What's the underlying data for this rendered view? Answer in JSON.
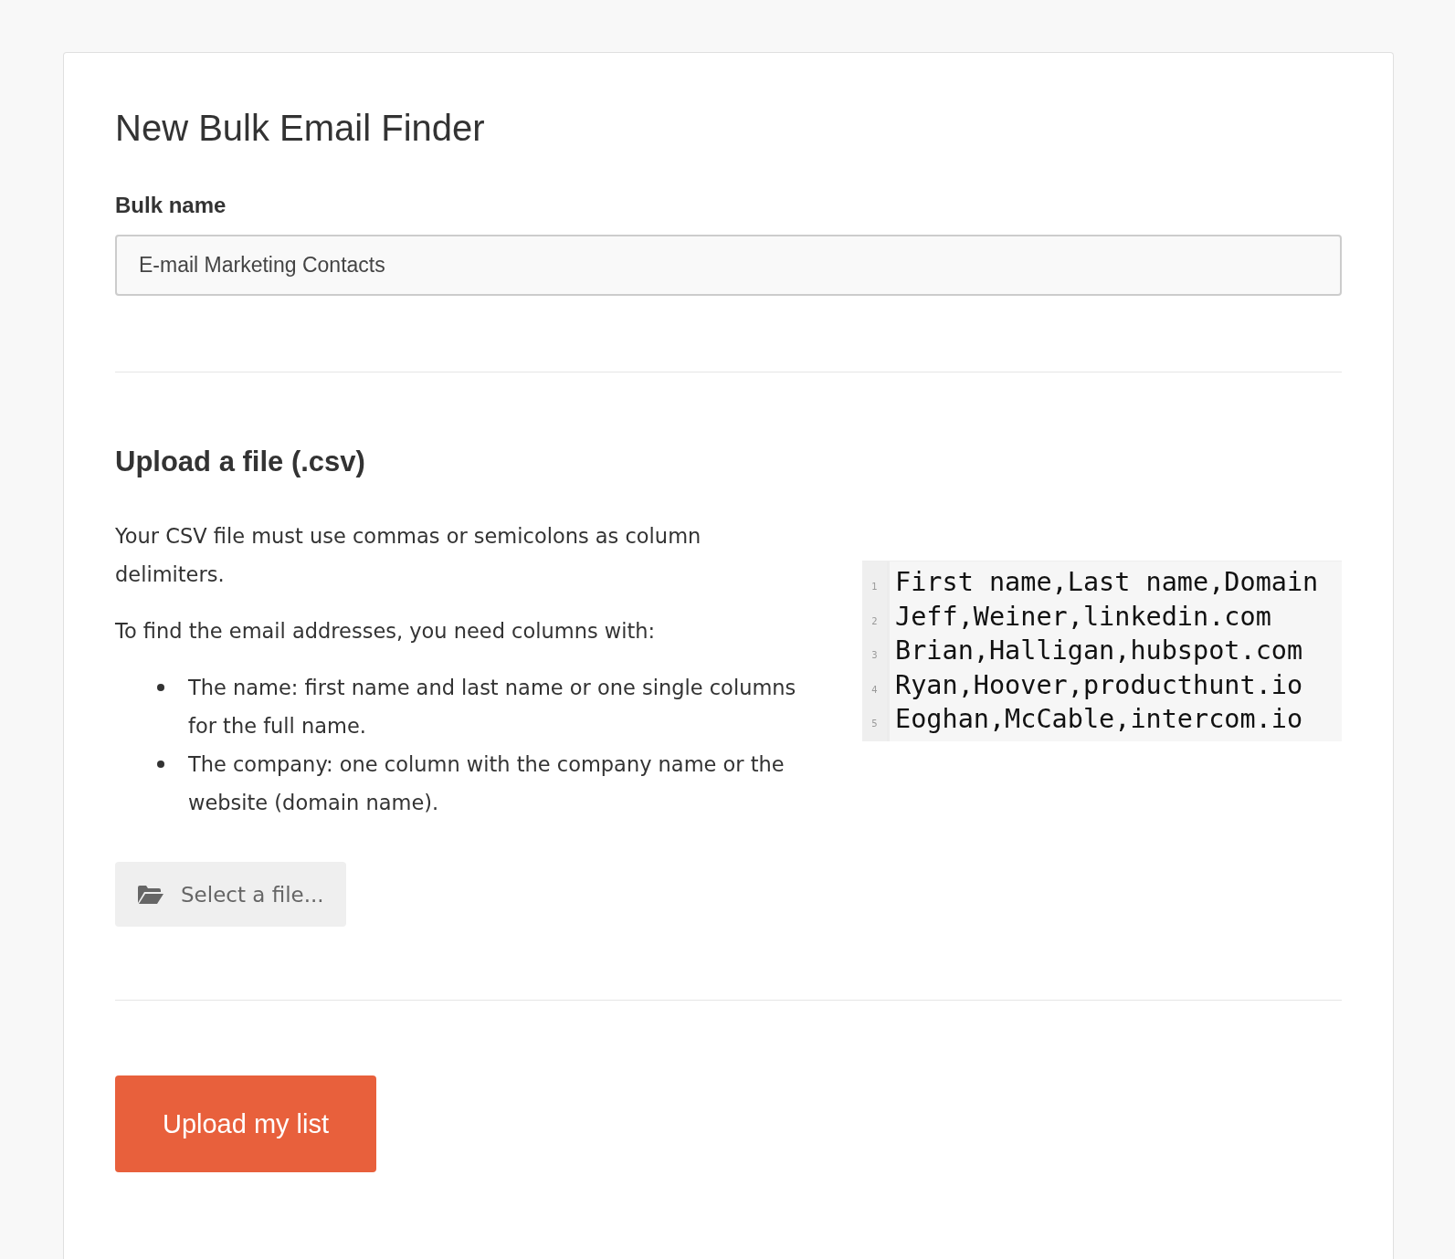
{
  "title": "New Bulk Email Finder",
  "bulk_name": {
    "label": "Bulk name",
    "value": "E-mail Marketing Contacts"
  },
  "upload": {
    "heading": "Upload a file (.csv)",
    "paragraphs": [
      "Your CSV file must use commas or semicolons as column delimiters.",
      "To find the email addresses, you need columns with:"
    ],
    "bullets": [
      "The name: first name and last name or one single columns for the full name.",
      "The company: one column with the company name or the website (domain name)."
    ],
    "sample": [
      {
        "number": "1",
        "text": "First name,Last name,Domain"
      },
      {
        "number": "2",
        "text": "Jeff,Weiner,linkedin.com"
      },
      {
        "number": "3",
        "text": "Brian,Halligan,hubspot.com"
      },
      {
        "number": "4",
        "text": "Ryan,Hoover,producthunt.io"
      },
      {
        "number": "5",
        "text": "Eoghan,McCable,intercom.io"
      }
    ],
    "select_button": "Select a file..."
  },
  "submit_button": "Upload my list"
}
